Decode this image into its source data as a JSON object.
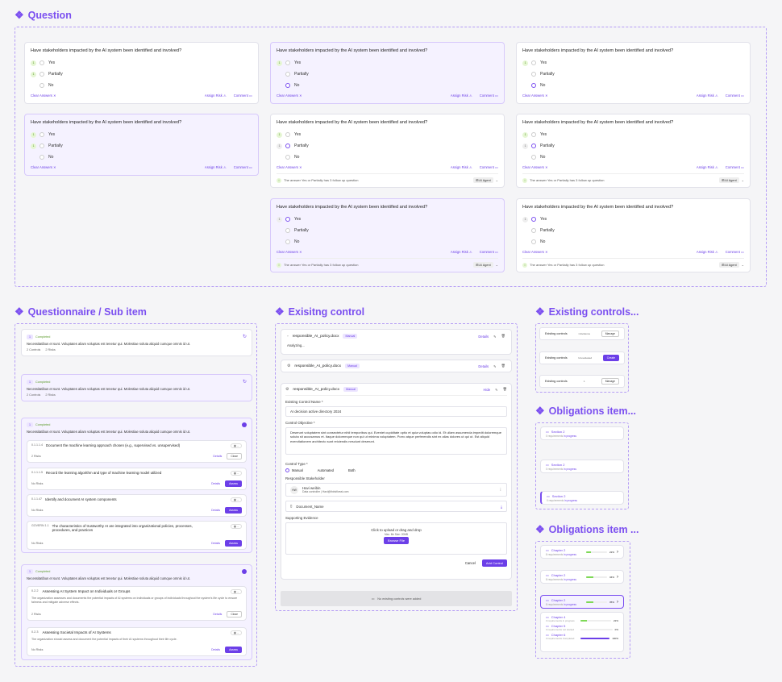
{
  "titles": {
    "question": "Question",
    "questionnaire": "Questionnaire / Sub item",
    "existing_control": "Exisitng control",
    "existing_controls": "Existing controls...",
    "obligations1": "Obligations item...",
    "obligations2": "Obligations item ..."
  },
  "question": {
    "text": "Have stakeholders impacted by the AI system been identified and involved?",
    "yes": "Yes",
    "partially": "Partially",
    "no": "No",
    "clear": "Clear Answers",
    "assign": "Assign Risk",
    "comment": "Comment",
    "followup": "The answer Yes or Partially has 3 follow up question",
    "agent": "AI Agent"
  },
  "qs": {
    "text": "Necessitatibus et sunt. Voluptates aliam voluptas est tenetur qui. Molestiae soluta aliquid cumque omnis id ut.",
    "status": "Completed",
    "controls": "2 Controls",
    "risks": "2 Risks",
    "c1": {
      "code": "0.1.1.1.4",
      "title": "Document the machine learning approach chosen (e.g., supervised vs. unsupervised)",
      "risks": "2 Risks",
      "details": "Details",
      "btn": "Close"
    },
    "c2": {
      "code": "0.1.1.1.5",
      "title": "Record the learning algorithm and type of machine learning model utilized",
      "risks": "No Risks",
      "details": "Details",
      "btn": "Assess"
    },
    "c3": {
      "code": "0.1.1.47",
      "title": "Identify and document AI system components",
      "risks": "No Risks",
      "details": "Details",
      "btn": "Assess"
    },
    "c4": {
      "code": "GOVERN 1.1",
      "title": "The characteristics of trustworthy AI are integrated into organizational policies, processes, procedures, and practices",
      "risks": "No Risks",
      "details": "Details",
      "btn": "Assess"
    },
    "s1": {
      "code": "0.2.2",
      "title": "Assessing AI System Impact on Individuals or Groups",
      "desc": "The organization assesses and documents the potential impacts of AI systems on individuals or groups of individuals throughout the system's life cycle to ensure fairness and mitigate adverse effects.",
      "risks": "2 Risks",
      "details": "Details",
      "btn": "Close"
    },
    "s2": {
      "code": "0.2.3",
      "title": "Assessing Societal Impacts of AI Systems",
      "desc": "The organization should assess and document the potential impacts of their AI systems throughout their life cycle.",
      "risks": "No Risks",
      "details": "Details",
      "btn": "Assess"
    }
  },
  "ec": {
    "file": "responsible_AI_policy.docx",
    "manual": "Manual",
    "details": "Details",
    "hide": "Hide",
    "analyzing": "Analyzing...",
    "name_label": "Existing Control Name *",
    "name_value": "AI decision active directory 2024",
    "obj_label": "Control Objective *",
    "obj_value": "Deserunt voluptatem sint consectetur nihil temporibus qui. Eveniet cupiditate optio et quia voluptas odio id. Et ullam assumenda impedit doloremque soluta sit accusamus et. Itaque doloremque non qui ut minima voluptatem. Porro atque perferendis sint ex alias dolores ut qui ut. Est aliquid exercitationem architecto sunt reiciendis nesciunt deserunt.",
    "type_label": "Control Type *",
    "types": [
      "Manual",
      "Automated",
      "Both"
    ],
    "stake_label": "Responsible Stakeholder",
    "stake_initials": "HW",
    "stake_name": "Havi weibin",
    "stake_sub": "Data controller | Havi@thinkfiveai.com",
    "doc": "Document_Name",
    "ev_label": "Supporting Evidence",
    "upload": "Click to upload or drag and drop",
    "upload_sub": "Max. file Size: 20MB",
    "browse": "Browse File",
    "cancel": "Cancel",
    "add": "Add Control",
    "empty": "No existing controls were added"
  },
  "ecs": {
    "label": "Existing controls",
    "r1": {
      "status": "1 Evidence",
      "btn": "Manage"
    },
    "r2": {
      "status": "Unevaluated",
      "btn": "Create"
    },
    "r3": {
      "status": "1",
      "btn": "Manage"
    }
  },
  "ob1": {
    "title": "Section 2",
    "sub": "0 requirements",
    "prog": "in progress"
  },
  "ob2": [
    {
      "title": "Chapter 2",
      "sub": "8 requirements",
      "prog": "in progress",
      "pct": "22%",
      "v": 0.22
    },
    {
      "title": "Chapter 2",
      "sub": "8 requirements",
      "prog": "in progress",
      "pct": "34%",
      "v": 0.34
    },
    {
      "title": "Chapter 2",
      "sub": "8 requirements",
      "prog": "in progress",
      "pct": "35%",
      "v": 0.35
    }
  ],
  "ob3": [
    {
      "title": "Chapter 4",
      "sub": "3 requirements in progress",
      "pct": "22%",
      "v": 0.22
    },
    {
      "title": "Chapter 5",
      "sub": "3 requirements not started",
      "pct": "0%",
      "v": 0
    },
    {
      "title": "Chapter 6",
      "sub": "3 requirements Completed",
      "pct": "100%",
      "v": 1
    }
  ]
}
